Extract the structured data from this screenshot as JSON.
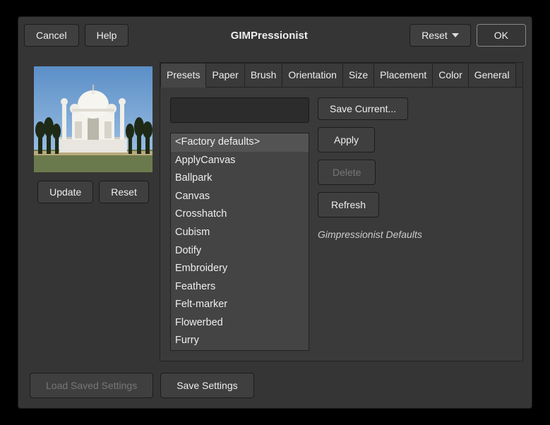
{
  "titlebar": {
    "cancel": "Cancel",
    "help": "Help",
    "title": "GIMPressionist",
    "reset": "Reset",
    "ok": "OK"
  },
  "preview": {
    "update": "Update",
    "reset": "Reset"
  },
  "tabs": [
    "Presets",
    "Paper",
    "Brush",
    "Orientation",
    "Size",
    "Placement",
    "Color",
    "General"
  ],
  "activeTab": 0,
  "presets": {
    "input_value": "",
    "save_current": "Save Current...",
    "apply": "Apply",
    "delete": "Delete",
    "refresh": "Refresh",
    "description": "Gimpressionist Defaults",
    "items": [
      "<Factory defaults>",
      "ApplyCanvas",
      "Ballpark",
      "Canvas",
      "Crosshatch",
      "Cubism",
      "Dotify",
      "Embroidery",
      "Feathers",
      "Felt-marker",
      "Flowerbed",
      "Furry"
    ],
    "selected": 0
  },
  "footer": {
    "load": "Load Saved Settings",
    "save": "Save Settings"
  }
}
